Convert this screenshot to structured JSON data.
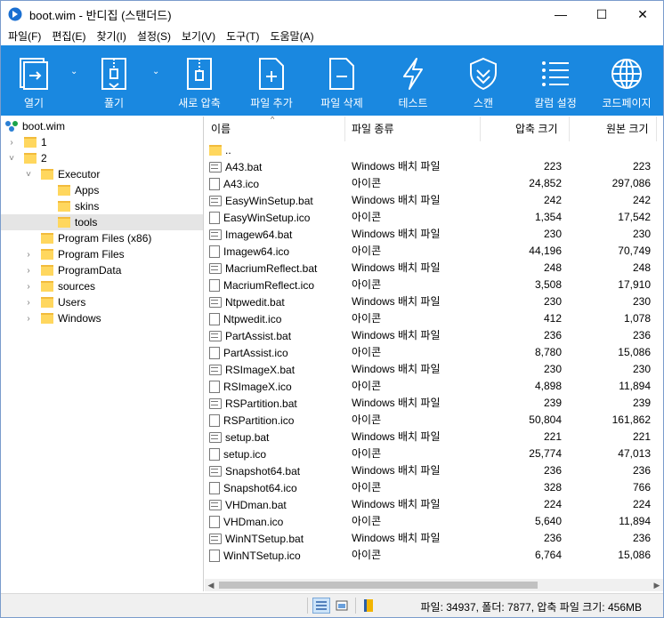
{
  "window": {
    "title": "boot.wim - 반디집 (스탠더드)",
    "minimize": "—",
    "maximize": "☐",
    "close": "✕"
  },
  "menu": [
    "파일(F)",
    "편집(E)",
    "찾기(I)",
    "설정(S)",
    "보기(V)",
    "도구(T)",
    "도움말(A)"
  ],
  "toolbar": {
    "open": "열기",
    "extract": "풀기",
    "new_archive": "새로 압축",
    "add_file": "파일 추가",
    "delete_file": "파일 삭제",
    "test": "테스트",
    "scan": "스캔",
    "column_settings": "칼럼 설정",
    "codepage": "코드페이지"
  },
  "tree": {
    "root": "boot.wim",
    "items": [
      {
        "label": "1",
        "level": 1,
        "arrow": "›"
      },
      {
        "label": "2",
        "level": 1,
        "arrow": "˅"
      },
      {
        "label": "Executor",
        "level": 2,
        "arrow": "˅"
      },
      {
        "label": "Apps",
        "level": 3,
        "arrow": ""
      },
      {
        "label": "skins",
        "level": 3,
        "arrow": ""
      },
      {
        "label": "tools",
        "level": 3,
        "arrow": "",
        "selected": true
      },
      {
        "label": "Program Files (x86)",
        "level": 2,
        "arrow": ""
      },
      {
        "label": "Program Files",
        "level": 2,
        "arrow": "›"
      },
      {
        "label": "ProgramData",
        "level": 2,
        "arrow": "›"
      },
      {
        "label": "sources",
        "level": 2,
        "arrow": "›"
      },
      {
        "label": "Users",
        "level": 2,
        "arrow": "›"
      },
      {
        "label": "Windows",
        "level": 2,
        "arrow": "›"
      }
    ]
  },
  "columns": {
    "name": "이름",
    "type": "파일 종류",
    "compressed": "압축 크기",
    "original": "원본 크기"
  },
  "parent_dir": "..",
  "files": [
    {
      "name": "A43.bat",
      "type": "Windows 배치 파일",
      "compressed": "223",
      "original": "223",
      "kind": "bat"
    },
    {
      "name": "A43.ico",
      "type": "아이콘",
      "compressed": "24,852",
      "original": "297,086",
      "kind": "ico"
    },
    {
      "name": "EasyWinSetup.bat",
      "type": "Windows 배치 파일",
      "compressed": "242",
      "original": "242",
      "kind": "bat"
    },
    {
      "name": "EasyWinSetup.ico",
      "type": "아이콘",
      "compressed": "1,354",
      "original": "17,542",
      "kind": "ico"
    },
    {
      "name": "Imagew64.bat",
      "type": "Windows 배치 파일",
      "compressed": "230",
      "original": "230",
      "kind": "bat"
    },
    {
      "name": "Imagew64.ico",
      "type": "아이콘",
      "compressed": "44,196",
      "original": "70,749",
      "kind": "ico"
    },
    {
      "name": "MacriumReflect.bat",
      "type": "Windows 배치 파일",
      "compressed": "248",
      "original": "248",
      "kind": "bat"
    },
    {
      "name": "MacriumReflect.ico",
      "type": "아이콘",
      "compressed": "3,508",
      "original": "17,910",
      "kind": "ico"
    },
    {
      "name": "Ntpwedit.bat",
      "type": "Windows 배치 파일",
      "compressed": "230",
      "original": "230",
      "kind": "bat"
    },
    {
      "name": "Ntpwedit.ico",
      "type": "아이콘",
      "compressed": "412",
      "original": "1,078",
      "kind": "ico"
    },
    {
      "name": "PartAssist.bat",
      "type": "Windows 배치 파일",
      "compressed": "236",
      "original": "236",
      "kind": "bat"
    },
    {
      "name": "PartAssist.ico",
      "type": "아이콘",
      "compressed": "8,780",
      "original": "15,086",
      "kind": "ico"
    },
    {
      "name": "RSImageX.bat",
      "type": "Windows 배치 파일",
      "compressed": "230",
      "original": "230",
      "kind": "bat"
    },
    {
      "name": "RSImageX.ico",
      "type": "아이콘",
      "compressed": "4,898",
      "original": "11,894",
      "kind": "ico"
    },
    {
      "name": "RSPartition.bat",
      "type": "Windows 배치 파일",
      "compressed": "239",
      "original": "239",
      "kind": "bat"
    },
    {
      "name": "RSPartition.ico",
      "type": "아이콘",
      "compressed": "50,804",
      "original": "161,862",
      "kind": "ico"
    },
    {
      "name": "setup.bat",
      "type": "Windows 배치 파일",
      "compressed": "221",
      "original": "221",
      "kind": "bat"
    },
    {
      "name": "setup.ico",
      "type": "아이콘",
      "compressed": "25,774",
      "original": "47,013",
      "kind": "ico"
    },
    {
      "name": "Snapshot64.bat",
      "type": "Windows 배치 파일",
      "compressed": "236",
      "original": "236",
      "kind": "bat"
    },
    {
      "name": "Snapshot64.ico",
      "type": "아이콘",
      "compressed": "328",
      "original": "766",
      "kind": "ico"
    },
    {
      "name": "VHDman.bat",
      "type": "Windows 배치 파일",
      "compressed": "224",
      "original": "224",
      "kind": "bat"
    },
    {
      "name": "VHDman.ico",
      "type": "아이콘",
      "compressed": "5,640",
      "original": "11,894",
      "kind": "ico"
    },
    {
      "name": "WinNTSetup.bat",
      "type": "Windows 배치 파일",
      "compressed": "236",
      "original": "236",
      "kind": "bat"
    },
    {
      "name": "WinNTSetup.ico",
      "type": "아이콘",
      "compressed": "6,764",
      "original": "15,086",
      "kind": "ico"
    }
  ],
  "status": {
    "text": "파일: 34937, 폴더: 7877, 압축 파일 크기: 456MB"
  },
  "colors": {
    "toolbar_bg": "#1a88e0",
    "folder": "#ffd75e",
    "selection": "#e5e5e5"
  }
}
